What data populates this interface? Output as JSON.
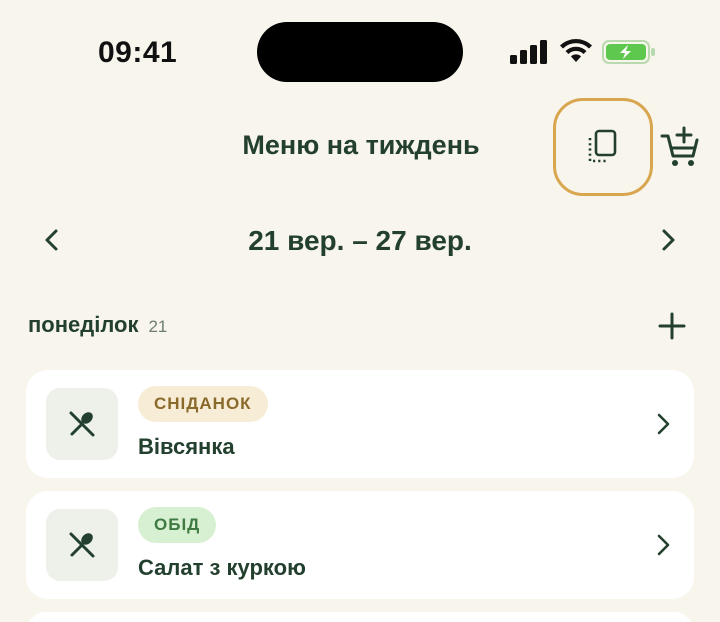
{
  "status_bar": {
    "time": "09:41",
    "icons": [
      "cellular-signal-icon",
      "wifi-icon",
      "battery-charging-icon"
    ],
    "battery_color": "#5ec84e"
  },
  "header": {
    "title": "Меню на тиждень",
    "copy_icon": "copy-week-icon",
    "cart_icon": "add-to-cart-icon",
    "highlight_color": "#d9a650"
  },
  "week_nav": {
    "range": "21 вер. – 27 вер.",
    "prev_icon": "chevron-left-icon",
    "next_icon": "chevron-right-icon"
  },
  "day": {
    "name": "понеділок",
    "number": "21",
    "add_icon": "plus-icon"
  },
  "meals": [
    {
      "type": "СНІДАНОК",
      "name": "Вівсянка",
      "icon": "utensils-icon"
    },
    {
      "type": "ОБІД",
      "name": "Салат з куркою",
      "icon": "utensils-icon"
    }
  ],
  "colors": {
    "background": "#f8f5ec",
    "text_primary": "#23402f",
    "card": "#ffffff",
    "breakfast_badge_bg": "#f7ecd6",
    "breakfast_badge_text": "#8a6a2a",
    "lunch_badge_bg": "#d8f0d2",
    "lunch_badge_text": "#3e7a42"
  }
}
